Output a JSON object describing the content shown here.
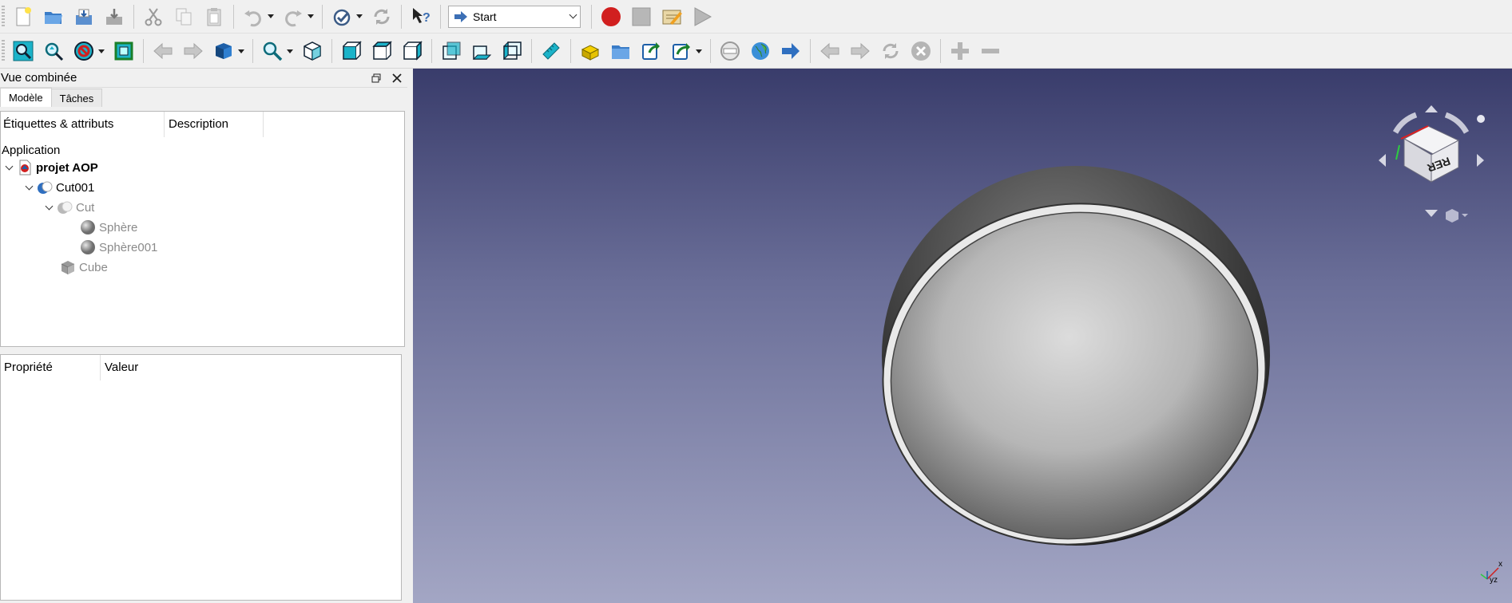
{
  "toolbar_top": {
    "workbench_selector": {
      "selected": "Start",
      "icon": "arrow-right-icon"
    },
    "buttons": [
      "new-document-icon",
      "open-folder-icon",
      "save-icon",
      "save-as-icon",
      "cut-icon",
      "copy-icon",
      "paste-icon",
      "undo-icon",
      "redo-icon",
      "refresh-icon",
      "whats-this-icon",
      "macro-record-icon",
      "macro-stop-icon",
      "macro-edit-icon",
      "macro-run-icon"
    ]
  },
  "toolbar_view": {
    "buttons": [
      "fit-all-icon",
      "fit-selection-icon",
      "draw-style-icon",
      "bounding-box-icon",
      "back-icon",
      "forward-icon",
      "std-views-icon",
      "zoom-icon",
      "isometric-icon",
      "front-view-icon",
      "top-view-icon",
      "right-view-icon",
      "rear-view-icon",
      "bottom-view-icon",
      "left-view-icon",
      "measure-icon",
      "part-icon",
      "group-icon",
      "link-icon",
      "link-actions-icon",
      "web-home-icon",
      "web-icon",
      "web-go-icon",
      "web-back-icon",
      "web-forward-icon",
      "web-refresh-icon",
      "web-stop-icon",
      "zoom-in-icon",
      "zoom-out-icon"
    ]
  },
  "combo_view": {
    "title": "Vue combinée",
    "tabs": [
      {
        "label": "Modèle",
        "active": true
      },
      {
        "label": "Tâches",
        "active": false
      }
    ],
    "tree": {
      "columns": [
        "Étiquettes & attributs",
        "Description"
      ],
      "root_label": "Application",
      "items": [
        {
          "label": "projet AOP",
          "level": 0,
          "expanded": true,
          "bold": true,
          "dim": false,
          "icon": "document-icon"
        },
        {
          "label": "Cut001",
          "level": 1,
          "expanded": true,
          "bold": false,
          "dim": false,
          "icon": "boolean-cut-icon"
        },
        {
          "label": "Cut",
          "level": 2,
          "expanded": true,
          "bold": false,
          "dim": true,
          "icon": "boolean-cut-icon"
        },
        {
          "label": "Sphère",
          "level": 3,
          "expanded": false,
          "bold": false,
          "dim": true,
          "icon": "sphere-icon"
        },
        {
          "label": "Sphère001",
          "level": 3,
          "expanded": false,
          "bold": false,
          "dim": true,
          "icon": "sphere-icon"
        },
        {
          "label": "Cube",
          "level": 2,
          "expanded": false,
          "bold": false,
          "dim": true,
          "icon": "cube-icon"
        }
      ]
    },
    "properties": {
      "columns": [
        "Propriété",
        "Valeur"
      ]
    }
  },
  "view3d": {
    "nav_cube_face_label": "RER",
    "axis_labels": {
      "x": "x",
      "yz": "yz"
    }
  },
  "colors": {
    "bg_top": "#393c6b",
    "bg_bottom": "#a3a6c4",
    "record_red": "#d11f1f",
    "view_cube_cyan": "#1bb3c9"
  }
}
